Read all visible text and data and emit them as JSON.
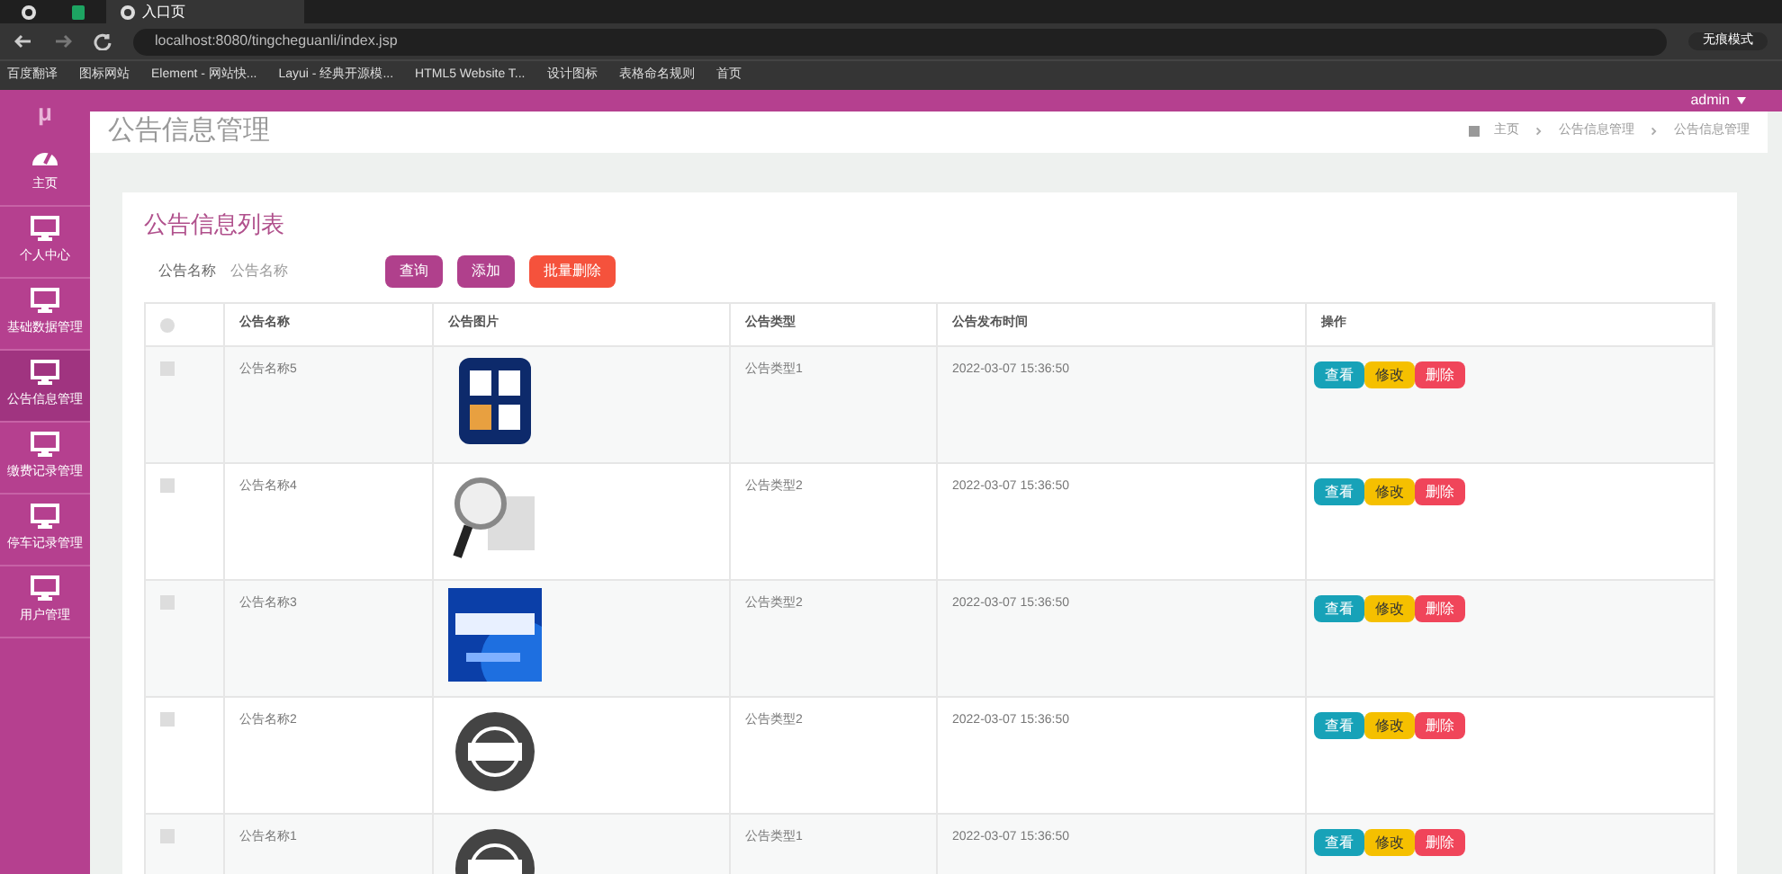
{
  "browser": {
    "tabs": [
      {
        "selected": false
      },
      {
        "selected": false
      },
      {
        "label": "入口页",
        "selected": true
      }
    ],
    "address": "localhost:8080/tingcheguanli/index.jsp",
    "profile": "无痕模式",
    "bookmarks": [
      "百度翻译",
      "图标网站",
      "Element - 网站快...",
      "Layui - 经典开源模...",
      "HTML5 Website T...",
      "设计图标",
      "表格命名规则",
      "首页"
    ]
  },
  "app": {
    "logo": "μ",
    "user": "admin",
    "page_title": "公告信息管理",
    "breadcrumb": [
      "主页",
      "公告信息管理",
      "公告信息管理"
    ]
  },
  "sidebar": {
    "items": [
      {
        "label": "主页",
        "selected": false
      },
      {
        "label": "个人中心",
        "selected": false
      },
      {
        "label": "基础数据管理",
        "selected": false
      },
      {
        "label": "公告信息管理",
        "selected": true
      },
      {
        "label": "缴费记录管理",
        "selected": false
      },
      {
        "label": "停车记录管理",
        "selected": false
      },
      {
        "label": "用户管理",
        "selected": false
      }
    ]
  },
  "card": {
    "title": "公告信息列表",
    "search_label": "公告名称",
    "search_placeholder": "公告名称",
    "buttons": [
      {
        "label": "查询",
        "kind": "primary"
      },
      {
        "label": "添加",
        "kind": "primary"
      },
      {
        "label": "批量删除",
        "kind": "danger"
      }
    ]
  },
  "table": {
    "select_all_checked": false,
    "columns": [
      "公告名称",
      "公告图片",
      "公告类型",
      "公告发布时间",
      "操作"
    ],
    "rows": [
      {
        "name": "公告名称5",
        "type": "公告类型1",
        "time": "2022-03-07 15:36:50",
        "checked": false,
        "actions": [
          {
            "label": "查看",
            "kind": "view"
          },
          {
            "label": "修改",
            "kind": "edit"
          },
          {
            "label": "删除",
            "kind": "delete"
          }
        ]
      },
      {
        "name": "公告名称4",
        "type": "公告类型2",
        "time": "2022-03-07 15:36:50",
        "checked": false,
        "actions": [
          {
            "label": "查看",
            "kind": "view"
          },
          {
            "label": "修改",
            "kind": "edit"
          },
          {
            "label": "删除",
            "kind": "delete"
          }
        ]
      },
      {
        "name": "公告名称3",
        "type": "公告类型2",
        "time": "2022-03-07 15:36:50",
        "checked": false,
        "actions": [
          {
            "label": "查看",
            "kind": "view"
          },
          {
            "label": "修改",
            "kind": "edit"
          },
          {
            "label": "删除",
            "kind": "delete"
          }
        ]
      },
      {
        "name": "公告名称2",
        "type": "公告类型2",
        "time": "2022-03-07 15:36:50",
        "checked": false,
        "actions": [
          {
            "label": "查看",
            "kind": "view"
          },
          {
            "label": "修改",
            "kind": "edit"
          },
          {
            "label": "删除",
            "kind": "delete"
          }
        ]
      },
      {
        "name": "公告名称1",
        "type": "公告类型1",
        "time": "2022-03-07 15:36:50",
        "checked": false,
        "actions": [
          {
            "label": "查看",
            "kind": "view"
          },
          {
            "label": "修改",
            "kind": "edit"
          },
          {
            "label": "删除",
            "kind": "delete"
          }
        ]
      }
    ]
  }
}
